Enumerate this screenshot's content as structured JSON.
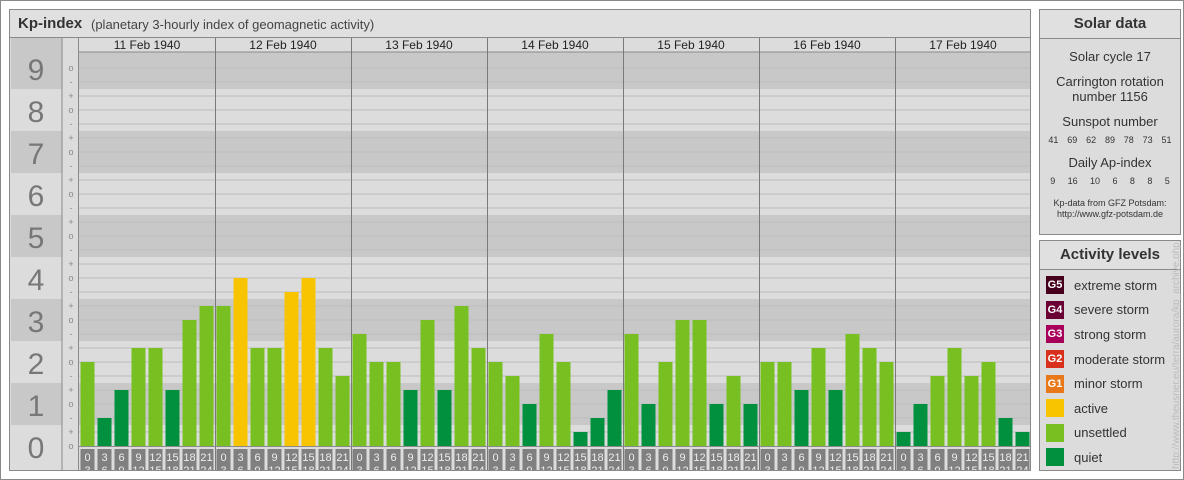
{
  "header": {
    "title": "Kp-index",
    "subtitle": "(planetary 3-hourly index of geomagnetic activity)"
  },
  "chart_data": {
    "type": "bar",
    "title": "Kp-index",
    "ylim": [
      0,
      9
    ],
    "y_ticks": [
      "0",
      "1",
      "2",
      "3",
      "4",
      "5",
      "6",
      "7",
      "8",
      "9"
    ],
    "sub_ticks": [
      "-",
      "o",
      "+"
    ],
    "days": [
      "11 Feb 1940",
      "12 Feb 1940",
      "13 Feb 1940",
      "14 Feb 1940",
      "15 Feb 1940",
      "16 Feb 1940",
      "17 Feb 1940"
    ],
    "intervals": [
      [
        "0",
        "3"
      ],
      [
        "3",
        "6"
      ],
      [
        "6",
        "9"
      ],
      [
        "9",
        "12"
      ],
      [
        "12",
        "15"
      ],
      [
        "15",
        "18"
      ],
      [
        "18",
        "21"
      ],
      [
        "21",
        "24"
      ]
    ],
    "values": [
      [
        "2o",
        "1-",
        "1+",
        "2+",
        "2+",
        "1+",
        "3o",
        "3+"
      ],
      [
        "3+",
        "4o",
        "2+",
        "2+",
        "4-",
        "4o",
        "2+",
        "2-"
      ],
      [
        "3-",
        "2o",
        "2o",
        "1+",
        "3o",
        "1+",
        "3+",
        "2+"
      ],
      [
        "2o",
        "2-",
        "1o",
        "3-",
        "2o",
        "0+",
        "1-",
        "1+"
      ],
      [
        "3-",
        "1o",
        "2o",
        "3o",
        "3o",
        "1o",
        "2-",
        "1o"
      ],
      [
        "2o",
        "2o",
        "1+",
        "2+",
        "1+",
        "3-",
        "2+",
        "2o"
      ],
      [
        "0+",
        "1o",
        "2-",
        "2+",
        "2-",
        "2o",
        "1-",
        "0+"
      ]
    ]
  },
  "colors": {
    "quiet": "#00903e",
    "unsettled": "#78bf22",
    "active": "#f8c400",
    "g1": "#e87818",
    "g2": "#d8301c",
    "g3": "#a8005a",
    "g4": "#6a0034",
    "g5": "#46001e"
  },
  "solar": {
    "title": "Solar data",
    "cycle": "Solar cycle 17",
    "carrington": "Carrington rotation number 1156",
    "sunspot_label": "Sunspot number",
    "sunspots": [
      "41",
      "69",
      "62",
      "89",
      "78",
      "73",
      "51"
    ],
    "ap_label": "Daily Ap-index",
    "ap": [
      "9",
      "16",
      "10",
      "6",
      "8",
      "8",
      "5"
    ],
    "source": "Kp-data from GFZ Potsdam:",
    "source_url": "http://www.gfz-potsdam.de"
  },
  "activity": {
    "title": "Activity levels",
    "levels": [
      {
        "badge": "G5",
        "label": "extreme storm",
        "color": "#46001e"
      },
      {
        "badge": "G4",
        "label": "severe storm",
        "color": "#6a0034"
      },
      {
        "badge": "G3",
        "label": "strong storm",
        "color": "#a8005a"
      },
      {
        "badge": "G2",
        "label": "moderate storm",
        "color": "#d8301c"
      },
      {
        "badge": "G1",
        "label": "minor storm",
        "color": "#e87818"
      },
      {
        "badge": "",
        "label": "active",
        "color": "#f8c400"
      },
      {
        "badge": "",
        "label": "unsettled",
        "color": "#78bf22"
      },
      {
        "badge": "",
        "label": "quiet",
        "color": "#00903e"
      }
    ]
  },
  "watermark": "http://www.theusner.eu/terra/aurora/kp_archive.php"
}
